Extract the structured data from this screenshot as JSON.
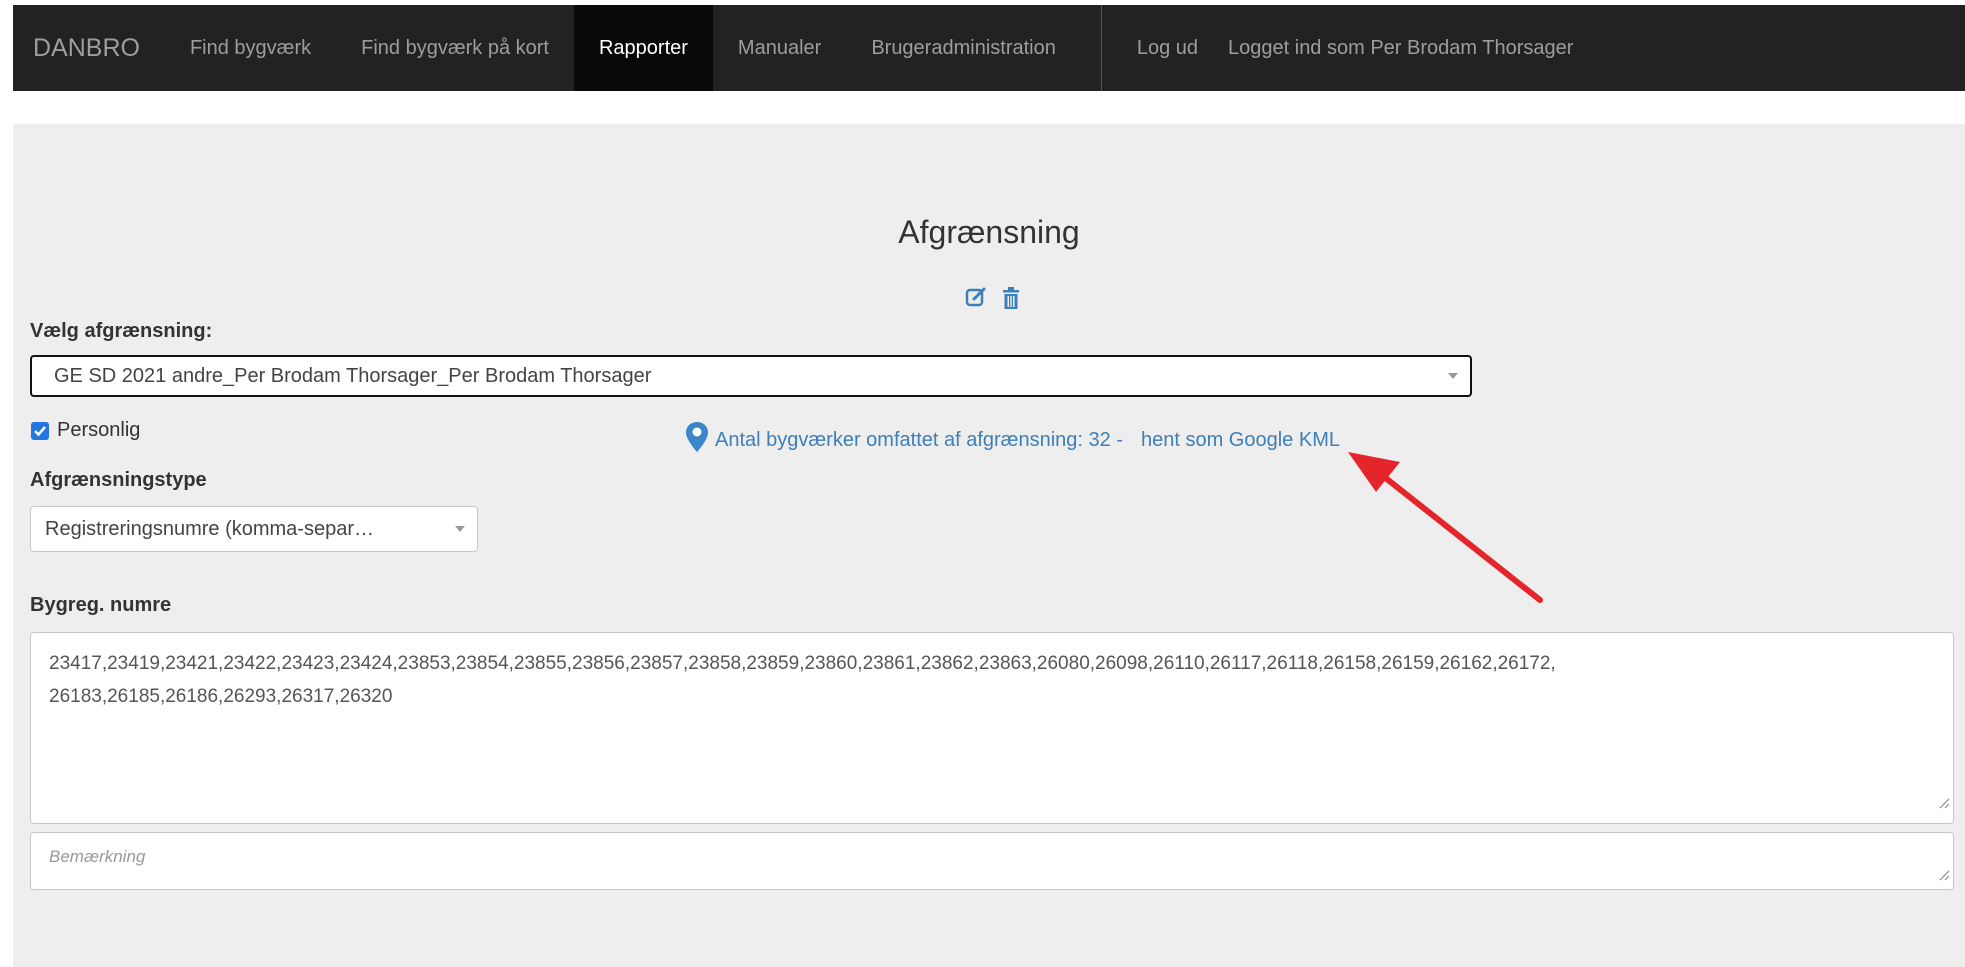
{
  "navbar": {
    "brand": "DANBRO",
    "items": [
      {
        "label": "Find bygværk"
      },
      {
        "label": "Find bygværk på kort"
      },
      {
        "label": "Rapporter"
      },
      {
        "label": "Manualer"
      },
      {
        "label": "Brugeradministration"
      }
    ],
    "logout": "Log ud",
    "logged_in": "Logget ind som Per Brodam Thorsager"
  },
  "main": {
    "title": "Afgrænsning",
    "edit_icon": "edit-icon",
    "delete_icon": "trash-icon",
    "select_label": "Vælg afgrænsning:",
    "selected_value": "GE SD 2021 andre_Per Brodam Thorsager_Per Brodam Thorsager",
    "personal_label": "Personlig",
    "personal_checked": true,
    "count_text": "Antal bygværker omfattet af afgrænsning: 32 -",
    "kml_link": "hent som Google KML",
    "type_label": "Afgrænsningstype",
    "type_value": "Registreringsnumre (komma-separ…",
    "numbers_label": "Bygreg. numre",
    "numbers_value": "23417,23419,23421,23422,23423,23424,23853,23854,23855,23856,23857,23858,23859,23860,23861,23862,23863,26080,26098,26110,26117,26118,26158,26159,26162,26172,\n26183,26185,26186,26293,26317,26320",
    "note_placeholder": "Bemærkning"
  },
  "colors": {
    "navbar_bg": "#222222",
    "active_bg": "#080808",
    "link": "#3d7fb9",
    "arrow": "#e5252c",
    "panel_bg": "#eeeeee"
  }
}
